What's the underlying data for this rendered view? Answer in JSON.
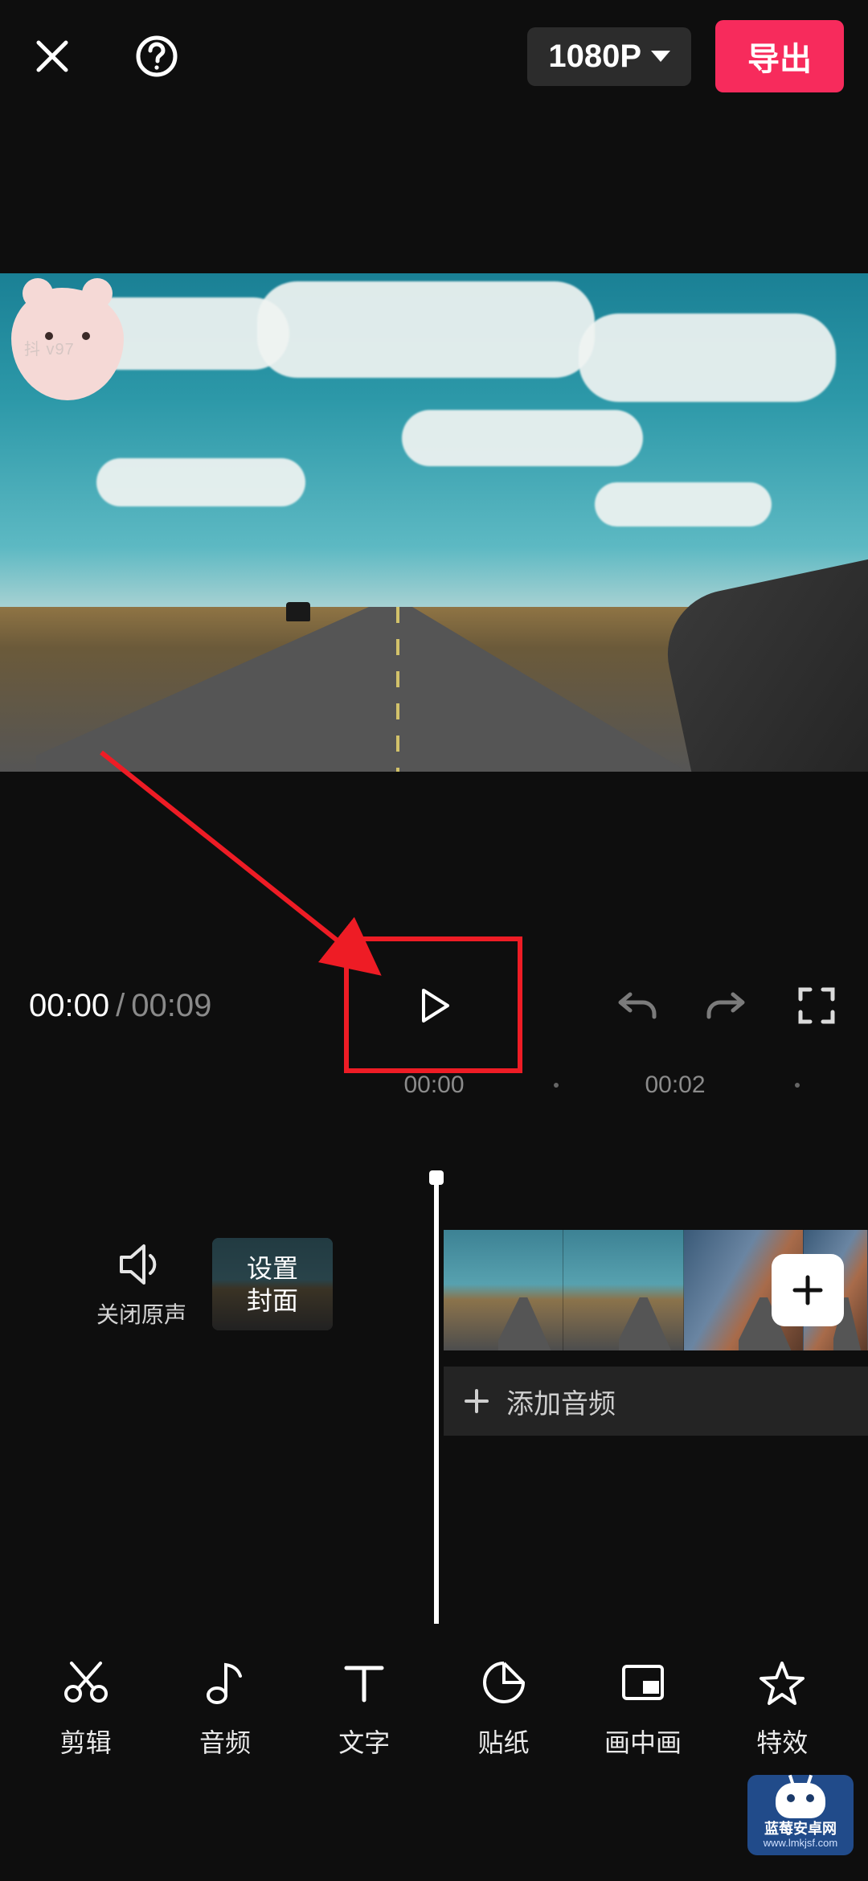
{
  "header": {
    "resolution_label": "1080P",
    "export_label": "导出"
  },
  "preview": {
    "watermark_text": "抖        v97"
  },
  "playback": {
    "current_time": "00:00",
    "separator": "/",
    "duration": "00:09"
  },
  "ruler": {
    "marks": [
      "00:00",
      "00:02"
    ]
  },
  "tracks": {
    "mute_label": "关闭原声",
    "cover_label": "设置\n封面",
    "add_audio_label": "添加音频"
  },
  "toolbar": {
    "items": [
      {
        "id": "edit",
        "label": "剪辑"
      },
      {
        "id": "audio",
        "label": "音频"
      },
      {
        "id": "text",
        "label": "文字"
      },
      {
        "id": "sticker",
        "label": "贴纸"
      },
      {
        "id": "pip",
        "label": "画中画"
      },
      {
        "id": "effect",
        "label": "特效"
      }
    ]
  },
  "site_badge": {
    "line1": "蓝莓安卓网",
    "line2": "www.lmkjsf.com"
  },
  "colors": {
    "accent": "#f72b5c",
    "highlight": "#ee1c25"
  }
}
